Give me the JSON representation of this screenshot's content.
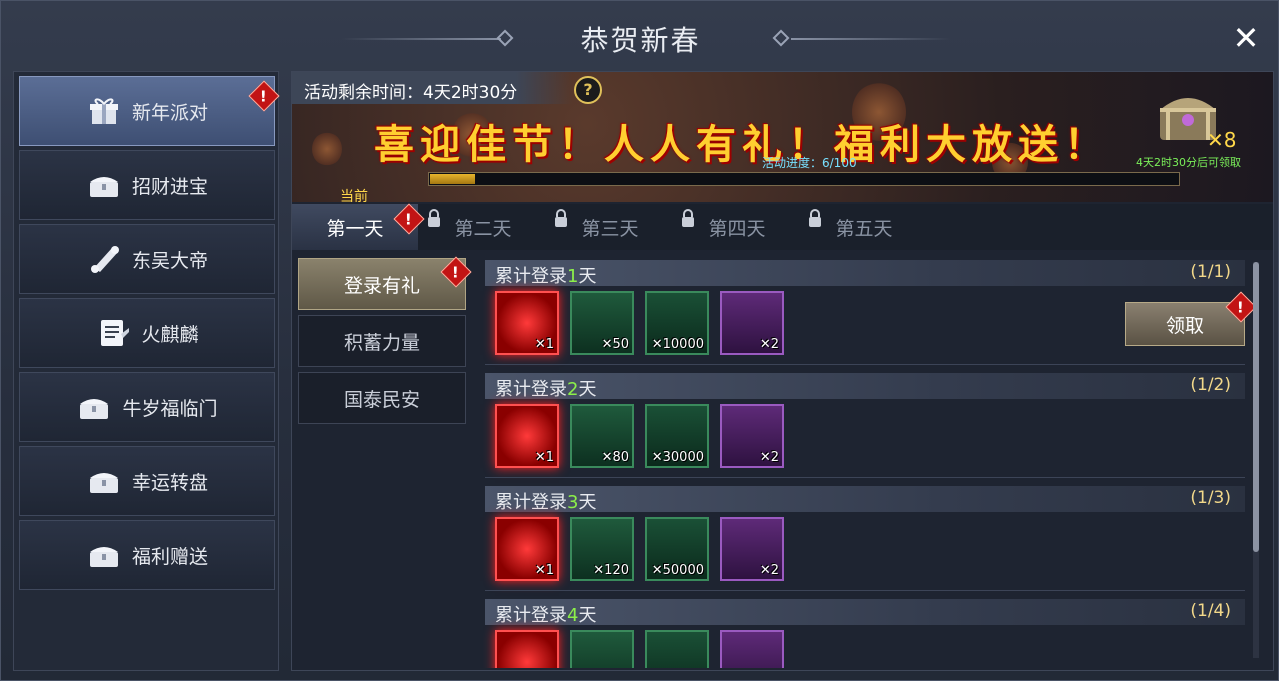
{
  "window": {
    "title": "恭贺新春",
    "close_label": "✕"
  },
  "sidebar": {
    "items": [
      {
        "label": "新年派对",
        "icon": "gift-icon",
        "active": true,
        "badge": "!"
      },
      {
        "label": "招财进宝",
        "icon": "chest-icon",
        "active": false
      },
      {
        "label": "东吴大帝",
        "icon": "scroll-icon",
        "active": false
      },
      {
        "label": "火麒麟",
        "icon": "document-icon",
        "active": false
      },
      {
        "label": "牛岁福临门",
        "icon": "chest-icon",
        "active": false
      },
      {
        "label": "幸运转盘",
        "icon": "chest-icon",
        "active": false
      },
      {
        "label": "福利赠送",
        "icon": "chest-icon",
        "active": false
      }
    ]
  },
  "banner": {
    "timer": "活动剩余时间：4天2时30分",
    "help": "?",
    "slogan": "喜迎佳节！人人有礼！福利大放送！",
    "progress_label": "活动进度：6/100",
    "progress_value": 6,
    "progress_max": 100,
    "current_label": "当前",
    "chest_count": "✕8",
    "chest_note": "4天2时30分后可领取"
  },
  "tabs": [
    {
      "label": "第一天",
      "active": true,
      "locked": false,
      "badge": "!"
    },
    {
      "label": "第二天",
      "active": false,
      "locked": true
    },
    {
      "label": "第三天",
      "active": false,
      "locked": true
    },
    {
      "label": "第四天",
      "active": false,
      "locked": true
    },
    {
      "label": "第五天",
      "active": false,
      "locked": true
    }
  ],
  "subtabs": [
    {
      "label": "登录有礼",
      "active": true,
      "badge": "!"
    },
    {
      "label": "积蓄力量",
      "active": false
    },
    {
      "label": "国泰民安",
      "active": false
    }
  ],
  "rewards": [
    {
      "title_prefix": "累计登录",
      "day": "1",
      "title_suffix": "天",
      "count": "(1/1)",
      "claim": "领取",
      "items": [
        {
          "icon": "hammer-icon",
          "qty": "✕1"
        },
        {
          "icon": "armor-icon",
          "qty": "✕50"
        },
        {
          "icon": "coin-icon",
          "qty": "✕10000"
        },
        {
          "icon": "toad-icon",
          "qty": "✕2"
        }
      ]
    },
    {
      "title_prefix": "累计登录",
      "day": "2",
      "title_suffix": "天",
      "count": "(1/2)",
      "items": [
        {
          "icon": "hammer-icon",
          "qty": "✕1"
        },
        {
          "icon": "armor-icon",
          "qty": "✕80"
        },
        {
          "icon": "coin-icon",
          "qty": "✕30000"
        },
        {
          "icon": "toad-icon",
          "qty": "✕2"
        }
      ]
    },
    {
      "title_prefix": "累计登录",
      "day": "3",
      "title_suffix": "天",
      "count": "(1/3)",
      "items": [
        {
          "icon": "hammer-icon",
          "qty": "✕1"
        },
        {
          "icon": "armor-icon",
          "qty": "✕120"
        },
        {
          "icon": "coin-icon",
          "qty": "✕50000"
        },
        {
          "icon": "toad-icon",
          "qty": "✕2"
        }
      ]
    },
    {
      "title_prefix": "累计登录",
      "day": "4",
      "title_suffix": "天",
      "count": "(1/4)",
      "items": [
        {
          "icon": "hammer-icon",
          "qty": ""
        },
        {
          "icon": "armor-icon",
          "qty": ""
        },
        {
          "icon": "coin-icon",
          "qty": ""
        },
        {
          "icon": "toad-icon",
          "qty": ""
        }
      ]
    }
  ],
  "colors": {
    "accent_gold": "#ffcf30",
    "badge_red": "#c21414",
    "highlight_green": "#8cf04a"
  }
}
